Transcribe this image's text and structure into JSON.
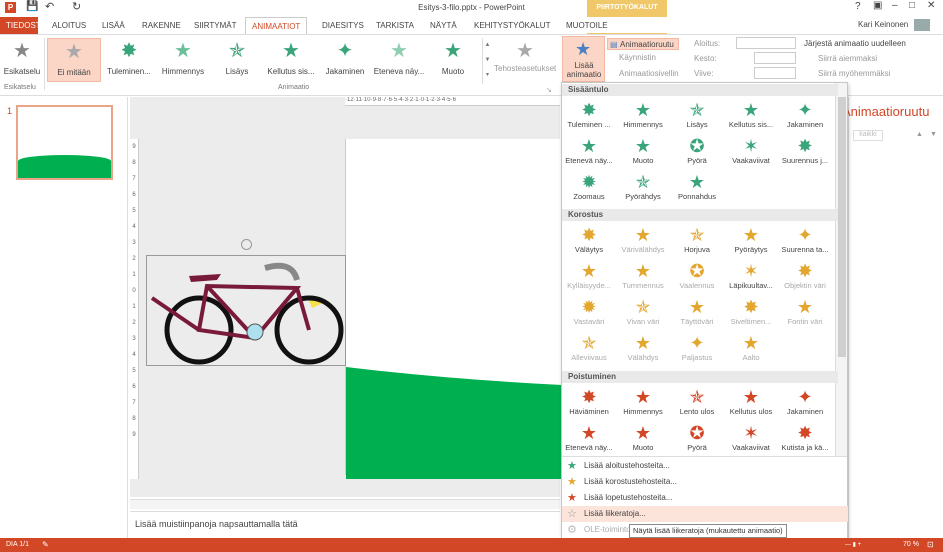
{
  "title_bar": {
    "title": "Esitys-3-filo.pptx - PowerPoint",
    "context_group": "PIIRTOTYÖKALUT",
    "user": "Kari Keinonen"
  },
  "tabs": [
    "TIEDOSTO",
    "ALOITUS",
    "LISÄÄ",
    "RAKENNE",
    "SIIRTYMÄT",
    "ANIMAATIOT",
    "DIAESITYS",
    "TARKISTA",
    "NÄYTÄ",
    "KEHITYSTYÖKALUT",
    "MUOTOILE"
  ],
  "ribbon": {
    "preview_label": "Esikatselu",
    "preview_group": "Esikatselu",
    "animation_group": "Animaatio",
    "gallery": [
      "Ei mitään",
      "Tuleminen...",
      "Himmennys",
      "Lisäys",
      "Kellutus sis...",
      "Jakaminen",
      "Eteneva näy...",
      "Muoto"
    ],
    "effect_options": "Tehosteasetukset",
    "add_animation": "Lisää animaatio",
    "anim_pane": "Animaatioruutu",
    "trigger": "Käynnistin",
    "anim_painter": "Animaatiosivellin",
    "start": "Aloitus:",
    "duration": "Kesto:",
    "delay": "Viive:",
    "reorder": "Järjestä animaatio uudelleen",
    "move_earlier": "Siirrä aiemmaksi",
    "move_later": "Siirrä myöhemmäksi"
  },
  "pane": {
    "title": "Animaatioruutu",
    "button": "kaikki"
  },
  "slide_panel": {
    "slide_number": "1"
  },
  "notes": "Lisää muistiinpanoja napsauttamalla tätä",
  "dropdown": {
    "entrance": {
      "title": "Sisääntulo",
      "items": [
        "Tuleminen ...",
        "Himmennys",
        "Lisäys",
        "Kellutus sis...",
        "Jakaminen",
        "Etenevä näy...",
        "Muoto",
        "Pyörä",
        "Vaakaviivat",
        "Suurennus j...",
        "Zoomaus",
        "Pyörähdys",
        "Ponnahdus"
      ]
    },
    "emphasis": {
      "title": "Korostus",
      "items": [
        "Väläytys",
        "Värivälähdys",
        "Horjuva",
        "Pyöräytys",
        "Suurenna ta...",
        "Kylläisyyde...",
        "Tummennus",
        "Vaalennus",
        "Läpikuultav...",
        "Objektin väri",
        "Vastaväri",
        "Vivan väri",
        "Täyttöväri",
        "Siveltimen...",
        "Fontin väri",
        "Alleviivaus",
        "Välähdys",
        "Paljastus",
        "Aalto"
      ]
    },
    "exit": {
      "title": "Poistuminen",
      "items": [
        "Häviäminen",
        "Himmennys",
        "Lento ulos",
        "Kellutus ulos",
        "Jakaminen",
        "Etenevä näy...",
        "Muoto",
        "Pyörä",
        "Vaakaviivat",
        "Kutista ja kä..."
      ]
    },
    "more": [
      "Lisää aloitustehosteita...",
      "Lisää korostustehosteita...",
      "Lisää lopetustehosteita...",
      "Lisää liikeratoja...",
      "OLE-toiminto"
    ]
  },
  "tooltip": "Näytä lisää liikeratoja (mukautettu animaatio)",
  "status": {
    "slide": "DIA 1/1",
    "zoom": "70 %"
  },
  "colors": {
    "accent": "#d24726",
    "green": "#00b050",
    "entrance": "#3aa57a",
    "emphasis": "#e3a72f",
    "exit": "#d24726"
  }
}
